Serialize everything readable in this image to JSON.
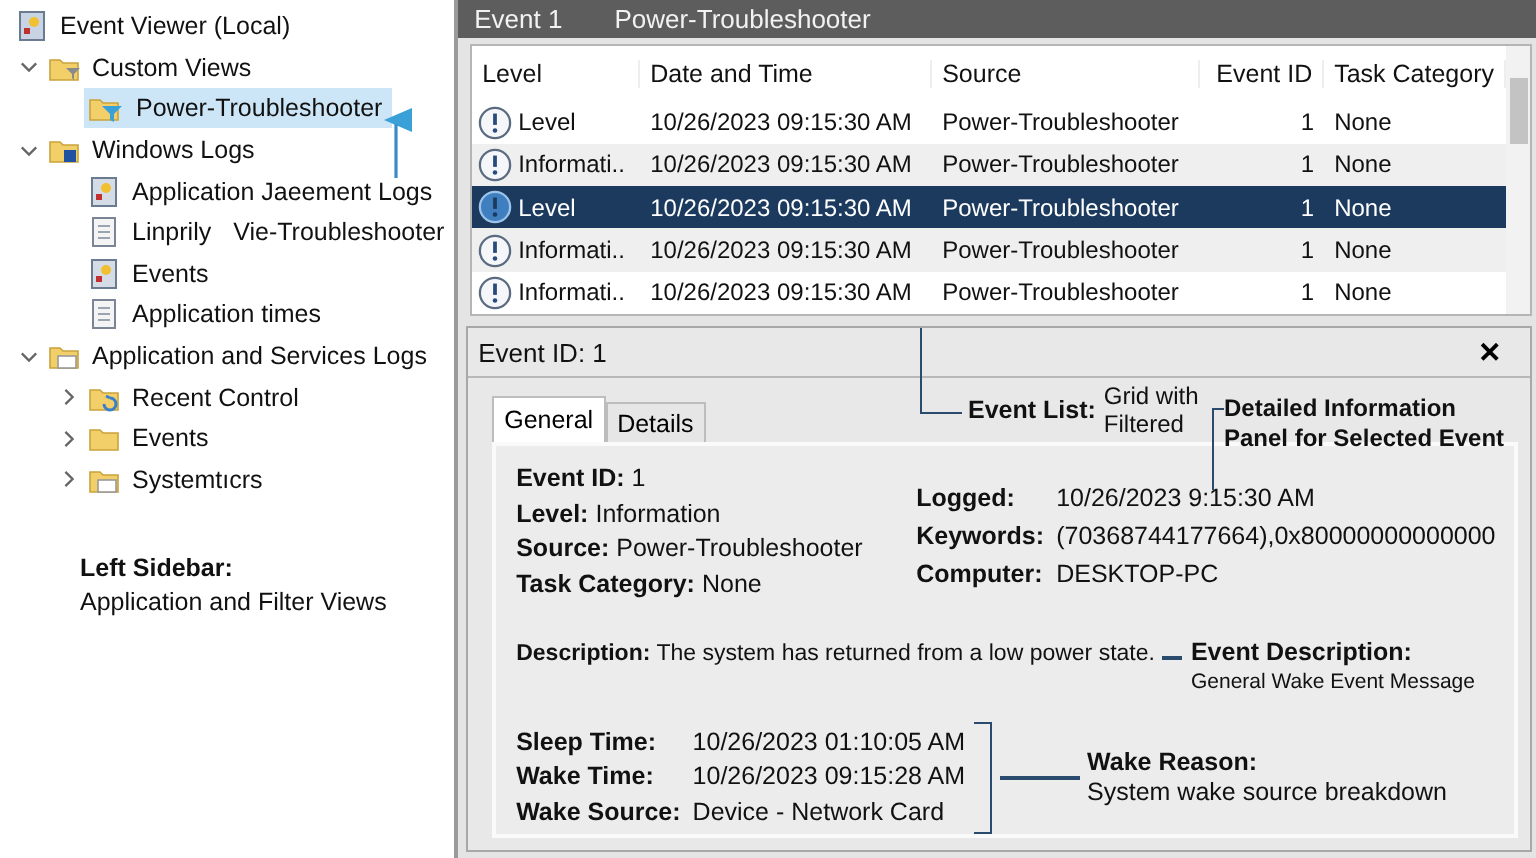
{
  "sidebar": {
    "tree": [
      {
        "label": "Event Viewer (Local)",
        "kind": "viewer",
        "selected": false
      },
      {
        "label": "Custom Views",
        "kind": "folder-filter",
        "expanded": true,
        "selected": false,
        "children": [
          {
            "label": "Power-Troubleshooter",
            "kind": "filter",
            "selected": true
          }
        ]
      },
      {
        "label": "Windows Logs",
        "kind": "folder-log",
        "expanded": true,
        "selected": false,
        "children": [
          {
            "label": "Application Jaeement Logs",
            "kind": "log",
            "selected": false
          },
          {
            "label": "Linprily",
            "label_2": "Vie-Troubleshooter",
            "kind": "page",
            "selected": false
          },
          {
            "label": "Events",
            "kind": "log",
            "selected": false
          },
          {
            "label": "Application times",
            "kind": "page",
            "selected": false
          }
        ]
      },
      {
        "label": "Application and Services Logs",
        "kind": "folder-doc",
        "expanded": true,
        "selected": false,
        "children": [
          {
            "label": "Recent Control",
            "kind": "folder-arrow",
            "expanded": false,
            "selected": false
          },
          {
            "label": "Events",
            "kind": "folder",
            "expanded": false,
            "selected": false
          },
          {
            "label": "Systemtıcrs",
            "kind": "folder-doc",
            "expanded": false,
            "selected": false
          }
        ]
      }
    ],
    "note": {
      "title": "Left Sidebar:",
      "text": "Application and Filter Views"
    }
  },
  "event_list": {
    "title": "Event 1",
    "subtitle": "Power-Troubleshooter",
    "columns": [
      "Level",
      "Date and Time",
      "Source",
      "Event ID",
      "Task Category"
    ],
    "rows": [
      {
        "level": "Level",
        "date": "10/26/2023 09:15:30 AM",
        "source": "Power-Troubleshooter",
        "event_id": "1",
        "task_category": "None",
        "selected": false
      },
      {
        "level": "Informati..",
        "date": "10/26/2023 09:15:30 AM",
        "source": "Power-Troubleshooter",
        "event_id": "1",
        "task_category": "None",
        "selected": false
      },
      {
        "level": "Level",
        "date": "10/26/2023 09:15:30 AM",
        "source": "Power-Troubleshooter",
        "event_id": "1",
        "task_category": "None",
        "selected": true
      },
      {
        "level": "Informati..",
        "date": "10/26/2023 09:15:30 AM",
        "source": "Power-Troubleshooter",
        "event_id": "1",
        "task_category": "None",
        "selected": false
      },
      {
        "level": "Informati..",
        "date": "10/26/2023 09:15:30 AM",
        "source": "Power-Troubleshooter",
        "event_id": "1",
        "task_category": "None",
        "selected": false
      }
    ]
  },
  "details": {
    "title": "Event ID: 1",
    "close": "✕",
    "tabs": [
      {
        "label": "General",
        "selected": true
      },
      {
        "label": "Details",
        "selected": false
      }
    ],
    "left_fields": [
      {
        "label": "Event ID:",
        "value": "1"
      },
      {
        "label": "Level:",
        "value": "Information"
      },
      {
        "label": "Source:",
        "value": "Power-Troubleshooter"
      },
      {
        "label": "Task Category:",
        "value": "None"
      }
    ],
    "right_fields": [
      {
        "label": "Logged:",
        "value": "10/26/2023 9:15:30 AM"
      },
      {
        "label": "Keywords:",
        "value": "(70368744177664),0x80000000000000"
      },
      {
        "label": "Computer:",
        "value": "DESKTOP-PC"
      }
    ],
    "description": {
      "label": "Description:",
      "value": "The system has returned from a low power state."
    },
    "wake_fields": [
      {
        "label": "Sleep Time:",
        "value": "10/26/2023 01:10:05 AM"
      },
      {
        "label": "Wake Time:",
        "value": "10/26/2023 09:15:28 AM"
      },
      {
        "label": "Wake Source:",
        "value": "Device - Network Card"
      }
    ]
  },
  "annotations": {
    "event_list": {
      "title": "Event List:",
      "text": "Grid with Filtered"
    },
    "detail_panel": {
      "title": "Detailed Information Panel for Selected Event"
    },
    "event_description": {
      "title": "Event Description:",
      "text": "General Wake Event Message"
    },
    "wake_reason": {
      "title": "Wake Reason:",
      "text": "System wake source breakdown"
    }
  }
}
